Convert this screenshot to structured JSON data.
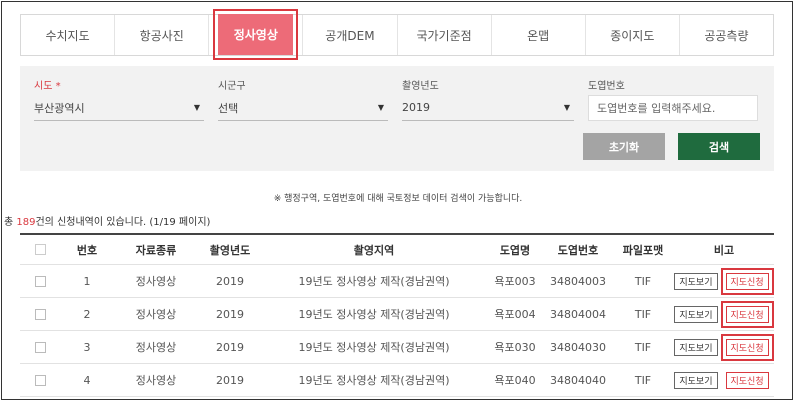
{
  "tabs": [
    "수치지도",
    "항공사진",
    "정사영상",
    "공개DEM",
    "국가기준점",
    "온맵",
    "종이지도",
    "공공측량"
  ],
  "active_tab": "정사영상",
  "search": {
    "sido": {
      "label": "시도",
      "required_mark": "*",
      "value": "부산광역시"
    },
    "sigungu": {
      "label": "시군구",
      "value": "선택"
    },
    "year": {
      "label": "촬영년도",
      "value": "2019"
    },
    "mapno": {
      "label": "도엽번호",
      "placeholder": "도엽번호를 입력해주세요."
    },
    "reset_label": "초기화",
    "search_label": "검색"
  },
  "note": "※ 행정구역, 도엽번호에 대해 국토정보 데이터 검색이 가능합니다.",
  "total": {
    "prefix": "총 ",
    "count": "189",
    "suffix": "건의 신청내역이 있습니다. (1/19 페이지)"
  },
  "table": {
    "headers": [
      "번호",
      "자료종류",
      "촬영년도",
      "촬영지역",
      "도엽명",
      "도엽번호",
      "파일포맷",
      "비고"
    ],
    "rows": [
      {
        "no": "1",
        "type": "정사영상",
        "year": "2019",
        "region": "19년도 정사영상 제작(경남권역)",
        "name": "욕포003",
        "code": "34804003",
        "format": "TIF"
      },
      {
        "no": "2",
        "type": "정사영상",
        "year": "2019",
        "region": "19년도 정사영상 제작(경남권역)",
        "name": "욕포004",
        "code": "34804004",
        "format": "TIF"
      },
      {
        "no": "3",
        "type": "정사영상",
        "year": "2019",
        "region": "19년도 정사영상 제작(경남권역)",
        "name": "욕포030",
        "code": "34804030",
        "format": "TIF"
      },
      {
        "no": "4",
        "type": "정사영상",
        "year": "2019",
        "region": "19년도 정사영상 제작(경남권역)",
        "name": "욕포040",
        "code": "34804040",
        "format": "TIF"
      }
    ],
    "view_label": "지도보기",
    "apply_label": "지도신청"
  },
  "colors": {
    "accent": "#d9383f",
    "tab_active": "#ed6b78",
    "search_btn": "#1f6b3e",
    "reset_btn": "#a4a4a4"
  }
}
